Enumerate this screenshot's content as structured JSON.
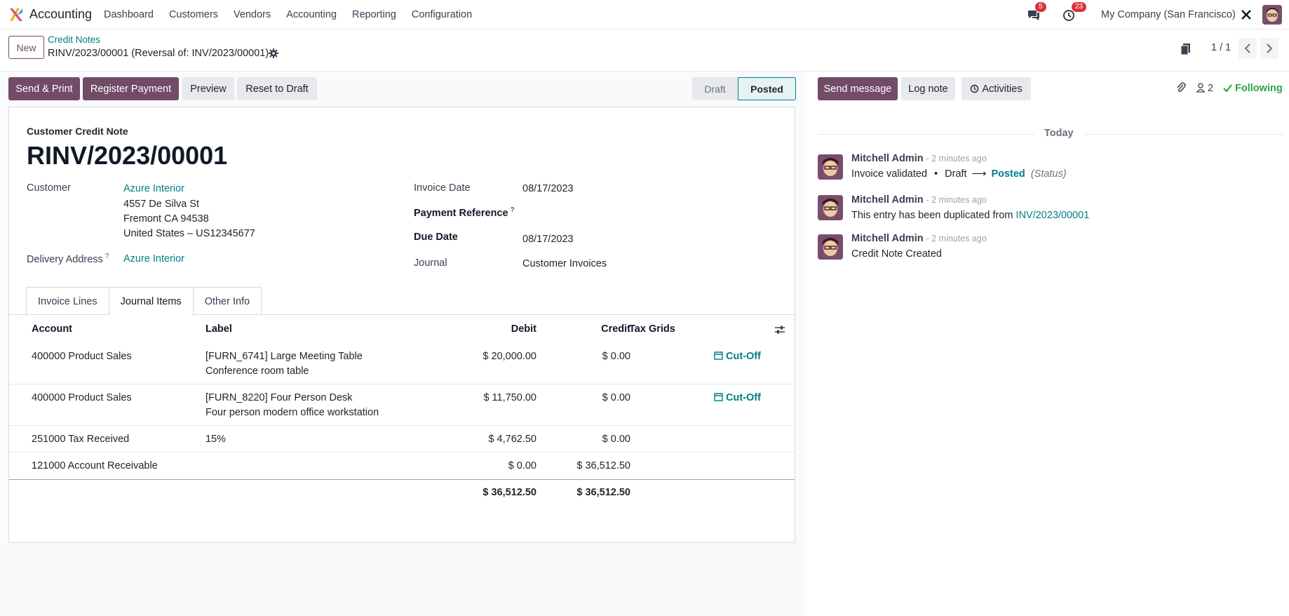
{
  "nav": {
    "app_name": "Accounting",
    "menu": [
      "Dashboard",
      "Customers",
      "Vendors",
      "Accounting",
      "Reporting",
      "Configuration"
    ],
    "messages_badge": "5",
    "activities_badge": "23",
    "company": "My Company (San Francisco)"
  },
  "control": {
    "new_label": "New",
    "breadcrumb_parent": "Credit Notes",
    "breadcrumb_current": "RINV/2023/00001 (Reversal of: INV/2023/00001)",
    "pager": "1 / 1"
  },
  "actions": {
    "send_print": "Send & Print",
    "register_payment": "Register Payment",
    "preview": "Preview",
    "reset_to_draft": "Reset to Draft"
  },
  "status": {
    "draft": "Draft",
    "posted": "Posted"
  },
  "chatter_actions": {
    "send_message": "Send message",
    "log_note": "Log note",
    "activities": "Activities",
    "followers_count": "2",
    "following": "Following"
  },
  "form": {
    "move_type": "Customer Credit Note",
    "name": "RINV/2023/00001",
    "customer_label": "Customer",
    "customer_name": "Azure Interior",
    "address_line1": "4557 De Silva St",
    "address_line2": "Fremont CA 94538",
    "address_line3": "United States – US12345677",
    "delivery_label": "Delivery Address",
    "delivery_value": "Azure Interior",
    "invoice_date_label": "Invoice Date",
    "invoice_date": "08/17/2023",
    "payment_ref_label": "Payment Reference",
    "due_date_label": "Due Date",
    "due_date": "08/17/2023",
    "journal_label": "Journal",
    "journal": "Customer Invoices"
  },
  "tabs": [
    "Invoice Lines",
    "Journal Items",
    "Other Info"
  ],
  "table": {
    "headers": {
      "account": "Account",
      "label": "Label",
      "debit": "Debit",
      "credit": "Credit",
      "tax_grids": "Tax Grids"
    },
    "rows": [
      {
        "account": "400000 Product Sales",
        "label1": "[FURN_6741] Large Meeting Table",
        "label2": "Conference room table",
        "debit": "$ 20,000.00",
        "credit": "$ 0.00",
        "cutoff": "Cut-Off"
      },
      {
        "account": "400000 Product Sales",
        "label1": "[FURN_8220] Four Person Desk",
        "label2": "Four person modern office workstation",
        "debit": "$ 11,750.00",
        "credit": "$ 0.00",
        "cutoff": "Cut-Off"
      },
      {
        "account": "251000 Tax Received",
        "label1": "15%",
        "label2": "",
        "debit": "$ 4,762.50",
        "credit": "$ 0.00",
        "cutoff": ""
      },
      {
        "account": "121000 Account Receivable",
        "label1": "",
        "label2": "",
        "debit": "$ 0.00",
        "credit": "$ 36,512.50",
        "cutoff": ""
      }
    ],
    "total_debit": "$ 36,512.50",
    "total_credit": "$ 36,512.50"
  },
  "chatter": {
    "today": "Today",
    "messages": [
      {
        "author": "Mitchell Admin",
        "time": "- 2 minutes ago",
        "body": "Invoice validated",
        "from": "Draft",
        "to": "Posted",
        "field": "(Status)"
      },
      {
        "author": "Mitchell Admin",
        "time": "- 2 minutes ago",
        "body": "This entry has been duplicated from",
        "link": "INV/2023/00001"
      },
      {
        "author": "Mitchell Admin",
        "time": "- 2 minutes ago",
        "body": "Credit Note Created"
      }
    ]
  },
  "colors": {
    "primary": "#714b67",
    "link": "#017e84",
    "badge": "#d9323e"
  }
}
